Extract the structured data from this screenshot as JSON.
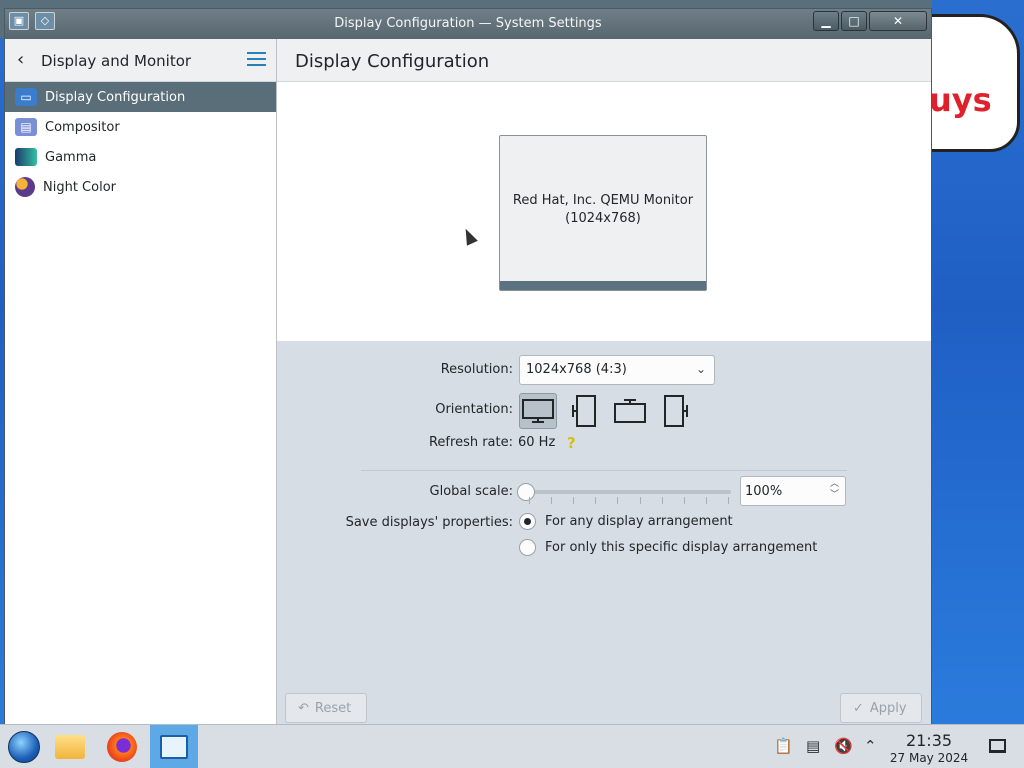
{
  "window": {
    "title": "Display Configuration — System Settings"
  },
  "desktop": {
    "bubble_text": "uys"
  },
  "sidebar": {
    "header": "Display and Monitor",
    "items": [
      {
        "label": "Display Configuration",
        "icon": "display-icon",
        "active": true
      },
      {
        "label": "Compositor",
        "icon": "compositor-icon",
        "active": false
      },
      {
        "label": "Gamma",
        "icon": "gamma-icon",
        "active": false
      },
      {
        "label": "Night Color",
        "icon": "night-color-icon",
        "active": false
      }
    ]
  },
  "main": {
    "title": "Display Configuration",
    "monitor": {
      "name": "Red Hat, Inc. QEMU Monitor",
      "resolution": "(1024x768)"
    },
    "resolution_label": "Resolution:",
    "resolution_value": "1024x768 (4:3)",
    "orientation_label": "Orientation:",
    "refresh_label": "Refresh rate:",
    "refresh_value": "60 Hz",
    "help_glyph": "?",
    "scale_label": "Global scale:",
    "scale_value": "100%",
    "scale_fraction": 0,
    "save_label": "Save displays' properties:",
    "save_options": [
      {
        "label": "For any display arrangement",
        "checked": true
      },
      {
        "label": "For only this specific display arrangement",
        "checked": false
      }
    ],
    "reset_label": "Reset",
    "apply_label": "Apply"
  },
  "taskbar": {
    "time": "21:35",
    "date": "27 May 2024"
  },
  "colors": {
    "accent": "#2980b9",
    "selection": "#5a6e7a",
    "taskbar_active": "#5fa8e6"
  }
}
